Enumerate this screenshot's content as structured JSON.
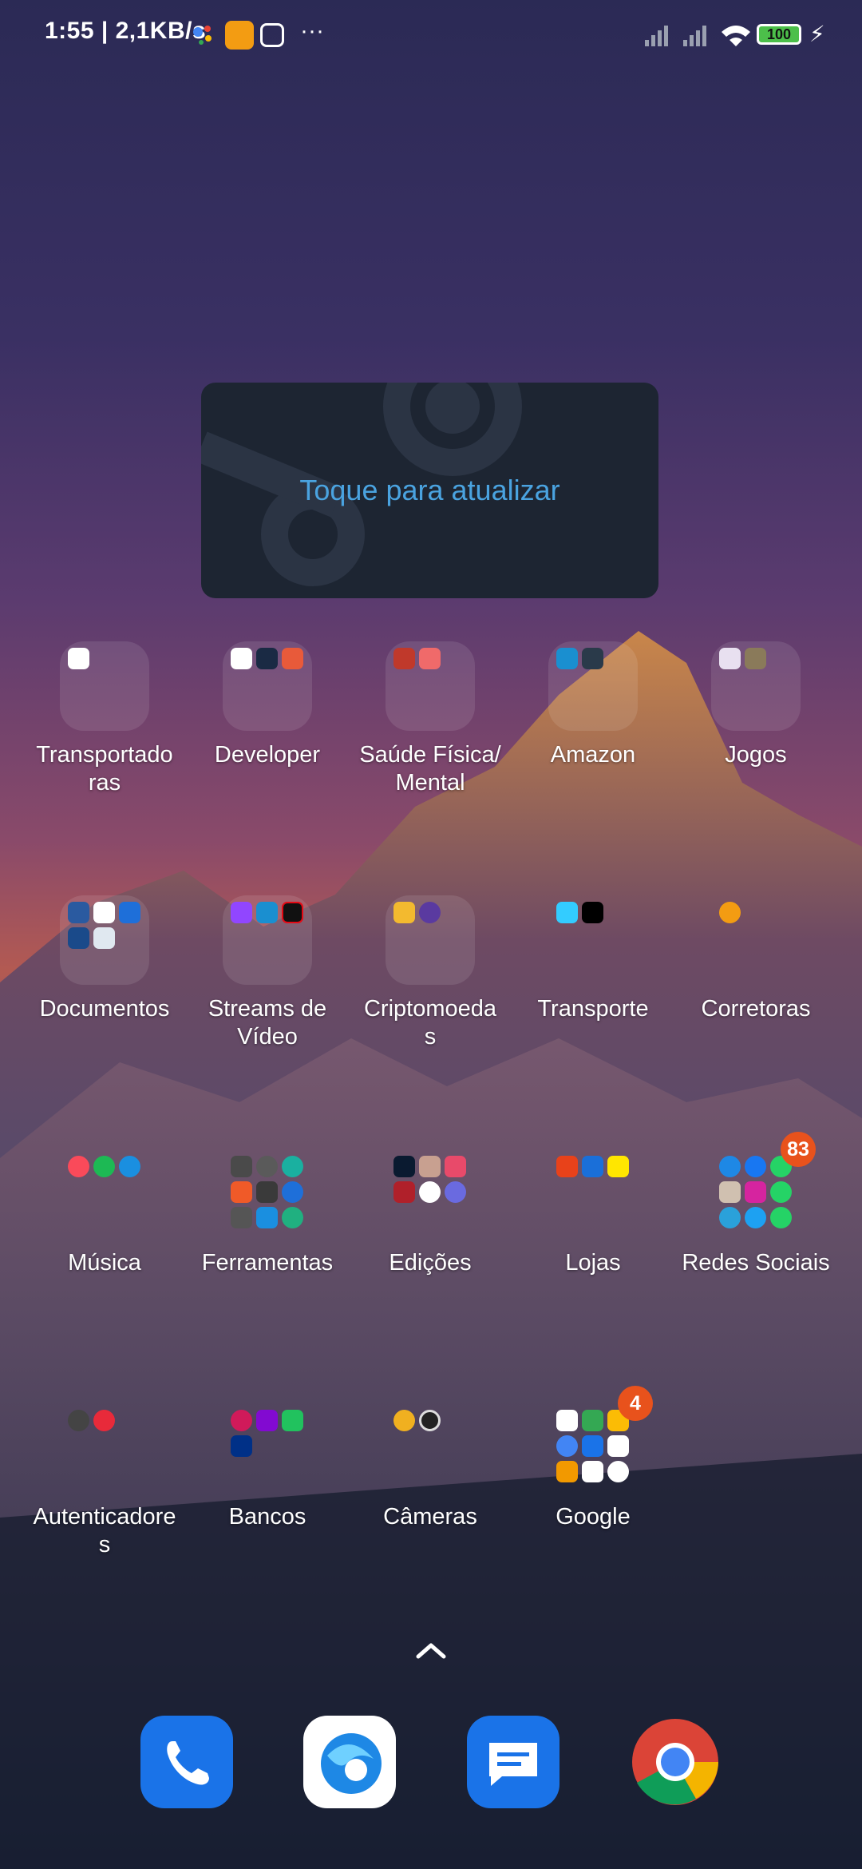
{
  "status_bar": {
    "time_speed": "1:55 | 2,1KB/s",
    "more_indicator": "···",
    "battery": "100",
    "icons": [
      "google-assistant-icon",
      "app-notification-icon",
      "instagram-icon",
      "signal-no-icon",
      "signal-icon",
      "wifi-icon",
      "battery-icon",
      "charging-icon"
    ]
  },
  "widget": {
    "text": "Toque para atualizar",
    "icon": "steam-icon"
  },
  "folders": [
    {
      "label": "Transportado ras",
      "label_display": "Transportado\nras"
    },
    {
      "label": "Developer"
    },
    {
      "label": "Saúde Física/ Mental",
      "label_display": "Saúde Física/\nMental"
    },
    {
      "label": "Amazon"
    },
    {
      "label": "Jogos"
    },
    {
      "label": "Documentos"
    },
    {
      "label": "Streams de Vídeo",
      "label_display": "Streams de\nVídeo"
    },
    {
      "label": "Criptomoeda s",
      "label_display": "Criptomoeda\ns"
    },
    {
      "label": "Transporte"
    },
    {
      "label": "Corretoras"
    },
    {
      "label": "Música"
    },
    {
      "label": "Ferramentas"
    },
    {
      "label": "Edições"
    },
    {
      "label": "Lojas"
    },
    {
      "label": "Redes Sociais",
      "badge": "83"
    },
    {
      "label": "Autenticadore s",
      "label_display": "Autenticadore\ns"
    },
    {
      "label": "Bancos"
    },
    {
      "label": "Câmeras"
    },
    {
      "label": "Google",
      "badge": "4"
    }
  ],
  "dock": [
    {
      "name": "phone-icon"
    },
    {
      "name": "browser-icon"
    },
    {
      "name": "messages-icon"
    },
    {
      "name": "chrome-icon"
    }
  ],
  "colors": {
    "accent_link": "#4aa3e0",
    "badge": "#e8521c",
    "widget_bg": "#1d2532"
  }
}
